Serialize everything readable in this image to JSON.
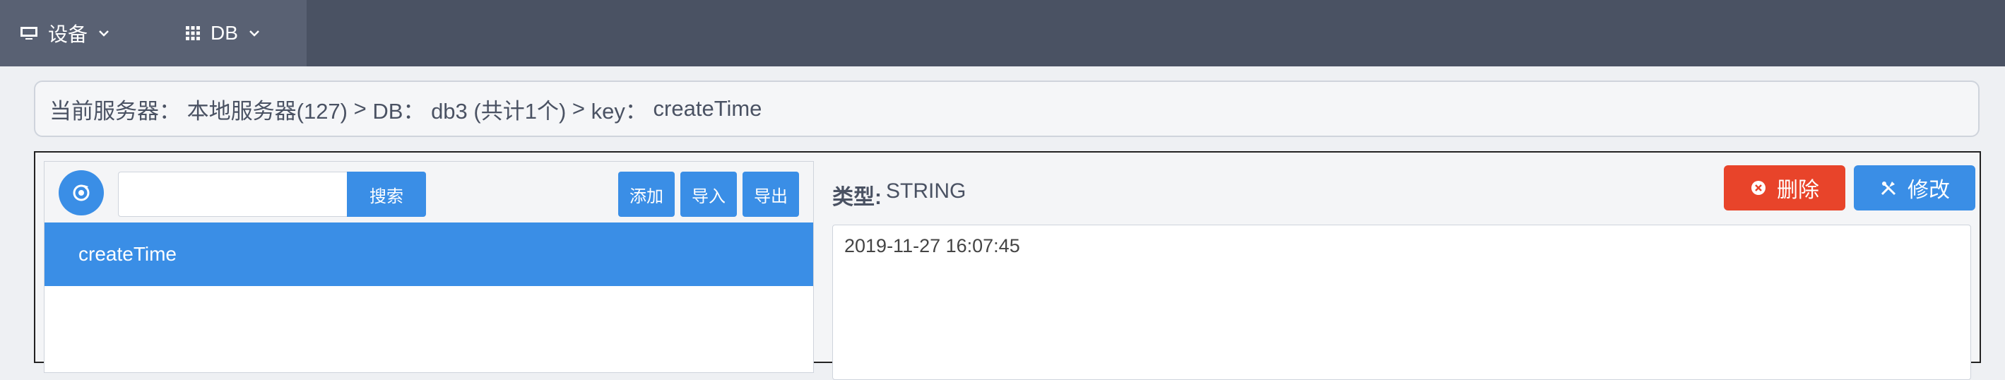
{
  "nav": {
    "devices_label": "设备",
    "db_label": "DB"
  },
  "breadcrumb": {
    "server_label": "当前服务器：",
    "server_value": "本地服务器(127)",
    "sep1": ">",
    "db_label": "DB：",
    "db_value": "db3 (共计1个)",
    "sep2": ">",
    "key_label": "key：",
    "key_value": "createTime"
  },
  "toolbar": {
    "search_placeholder": "",
    "search_label": "搜索",
    "add_label": "添加",
    "import_label": "导入",
    "export_label": "导出"
  },
  "keys": [
    {
      "name": "createTime"
    }
  ],
  "detail": {
    "type_label": "类型:",
    "type_value": "STRING",
    "delete_label": "删除",
    "edit_label": "修改",
    "value": "2019-11-27 16:07:45"
  },
  "colors": {
    "topbar": "#4a5263",
    "primary": "#3a8ee6",
    "danger": "#e8442a"
  }
}
